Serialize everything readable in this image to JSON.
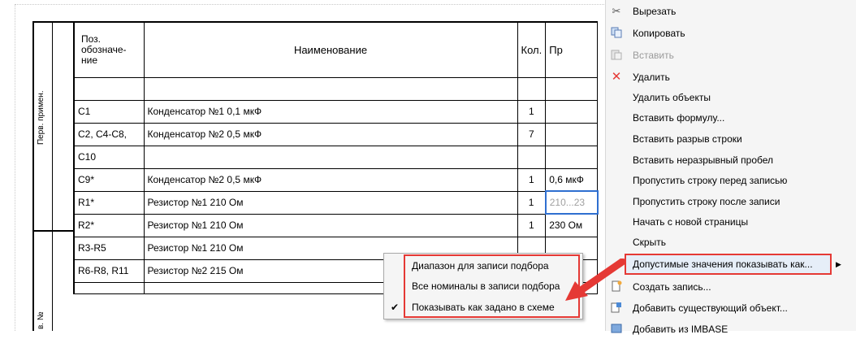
{
  "sheet": {
    "vertical_labels": [
      "Перв. примен.",
      "в. №"
    ]
  },
  "table": {
    "headers": {
      "pos": [
        "Поз.",
        "обозначе-",
        "ние"
      ],
      "name": "Наименование",
      "qty": "Кол.",
      "note": "Пр"
    },
    "rows": [
      {
        "pos": "",
        "name": "",
        "qty": "",
        "note": ""
      },
      {
        "pos": "C1",
        "name": "Конденсатор №1 0,1 мкФ",
        "qty": "1",
        "note": ""
      },
      {
        "pos": "C2, C4-C8,",
        "name": "Конденсатор №2 0,5 мкФ",
        "qty": "7",
        "note": ""
      },
      {
        "pos": "C10",
        "name": "",
        "qty": "",
        "note": ""
      },
      {
        "pos": "C9*",
        "name": "Конденсатор №2 0,5 мкФ",
        "qty": "1",
        "note": "0,6 мкФ"
      },
      {
        "pos": "R1*",
        "name": "Резистор №1 210 Ом",
        "qty": "1",
        "note": "210...23"
      },
      {
        "pos": "R2*",
        "name": "Резистор №1 210 Ом",
        "qty": "1",
        "note": "230 Ом"
      },
      {
        "pos": "R3-R5",
        "name": "Резистор №1 210 Ом",
        "qty": "",
        "note": ""
      },
      {
        "pos": "R6-R8, R11",
        "name": "Резистор №2 215 Ом",
        "qty": "",
        "note": ""
      }
    ]
  },
  "context_menu": {
    "items": [
      {
        "label": "Вырезать",
        "icon": "scissors-icon",
        "disabled": false
      },
      {
        "label": "Копировать",
        "icon": "copy-icon",
        "disabled": false
      },
      {
        "label": "Вставить",
        "icon": "paste-icon",
        "disabled": true
      },
      {
        "label": "Удалить",
        "icon": "delete-x-icon",
        "disabled": false
      },
      {
        "label": "Удалить объекты",
        "icon": "",
        "disabled": false
      },
      {
        "label": "Вставить формулу...",
        "icon": "",
        "disabled": false
      },
      {
        "label": "Вставить разрыв строки",
        "icon": "",
        "disabled": false
      },
      {
        "label": "Вставить неразрывный пробел",
        "icon": "",
        "disabled": false
      },
      {
        "label": "Пропустить строку перед записью",
        "icon": "",
        "disabled": false
      },
      {
        "label": "Пропустить строку после записи",
        "icon": "",
        "disabled": false
      },
      {
        "label": "Начать с новой страницы",
        "icon": "",
        "disabled": false
      },
      {
        "label": "Скрыть",
        "icon": "",
        "disabled": false
      },
      {
        "label": "Допустимые значения показывать как...",
        "icon": "",
        "disabled": false,
        "has_submenu": true,
        "highlighted": true
      },
      {
        "label": "Создать запись...",
        "icon": "new-record-icon",
        "disabled": false
      },
      {
        "label": "Добавить существующий объект...",
        "icon": "add-object-icon",
        "disabled": false
      },
      {
        "label": "Добавить из IMBASE",
        "icon": "imbase-icon",
        "disabled": false
      }
    ],
    "submenu_arrow": "▶"
  },
  "submenu": {
    "items": [
      {
        "label": "Диапазон для записи подбора",
        "checked": false
      },
      {
        "label": "Все номиналы в записи подбора",
        "checked": false
      },
      {
        "label": "Показывать как задано в схеме",
        "checked": true
      }
    ],
    "check_glyph": "✔"
  },
  "colors": {
    "highlight_border": "#e53935",
    "selection_border": "#2f6fd0",
    "menu_bg": "#f5f5f5"
  }
}
